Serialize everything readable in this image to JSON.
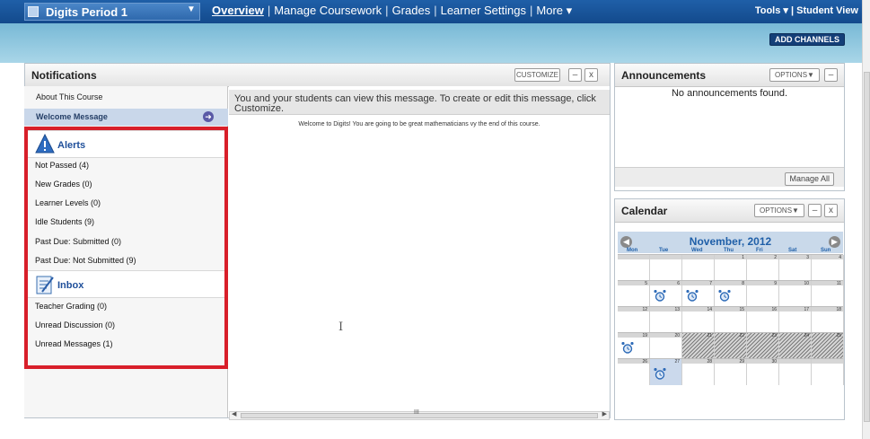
{
  "topnav": {
    "course": "Digits Period 1",
    "items": [
      "Overview",
      "Manage Coursework",
      "Grades",
      "Learner Settings",
      "More ▾"
    ],
    "tools": "Tools ▾ | Student View"
  },
  "add_channels": "ADD CHANNELS",
  "notifications": {
    "title": "Notifications",
    "customize": "CUSTOMIZE",
    "minimize": "–",
    "close": "x",
    "about": "About This Course",
    "welcome": "Welcome Message",
    "message_bar": "You and your students can view this message. To create or edit this message, click Customize.",
    "welcome_text": "Welcome to Digits! You are going to be great mathematicians vy the end of this course.",
    "alerts": {
      "label": "Alerts",
      "items": [
        "Not Passed (4)",
        "New Grades (0)",
        "Learner Levels (0)",
        "Idle Students (9)",
        "Past Due: Submitted (0)",
        "Past Due: Not Submitted (9)"
      ]
    },
    "inbox": {
      "label": "Inbox",
      "items": [
        "Teacher Grading (0)",
        "Unread Discussion (0)",
        "Unread Messages (1)"
      ]
    },
    "hscroll_mark": "III"
  },
  "announcements": {
    "title": "Announcements",
    "options": "OPTIONS▼",
    "minimize": "–",
    "empty": "No announcements found.",
    "manage": "Manage All"
  },
  "calendar": {
    "title": "Calendar",
    "options": "OPTIONS▼",
    "minimize": "–",
    "close": "x",
    "month": "November, 2012",
    "days": [
      "Mon",
      "Tue",
      "Wed",
      "Thu",
      "Fri",
      "Sat",
      "Sun"
    ],
    "weeks": [
      [
        "",
        "",
        "",
        "1",
        "2",
        "3",
        "4"
      ],
      [
        "5",
        "6",
        "7",
        "8",
        "9",
        "10",
        "11"
      ],
      [
        "12",
        "13",
        "14",
        "15",
        "16",
        "17",
        "18"
      ],
      [
        "19",
        "20",
        "21",
        "22",
        "23",
        "24",
        "25"
      ],
      [
        "26",
        "27",
        "28",
        "29",
        "30",
        "",
        ""
      ]
    ],
    "event_days": [
      "6",
      "7",
      "8",
      "19",
      "27"
    ],
    "unavailable_days": [
      "21",
      "22",
      "23",
      "24",
      "25"
    ],
    "today": "27"
  }
}
